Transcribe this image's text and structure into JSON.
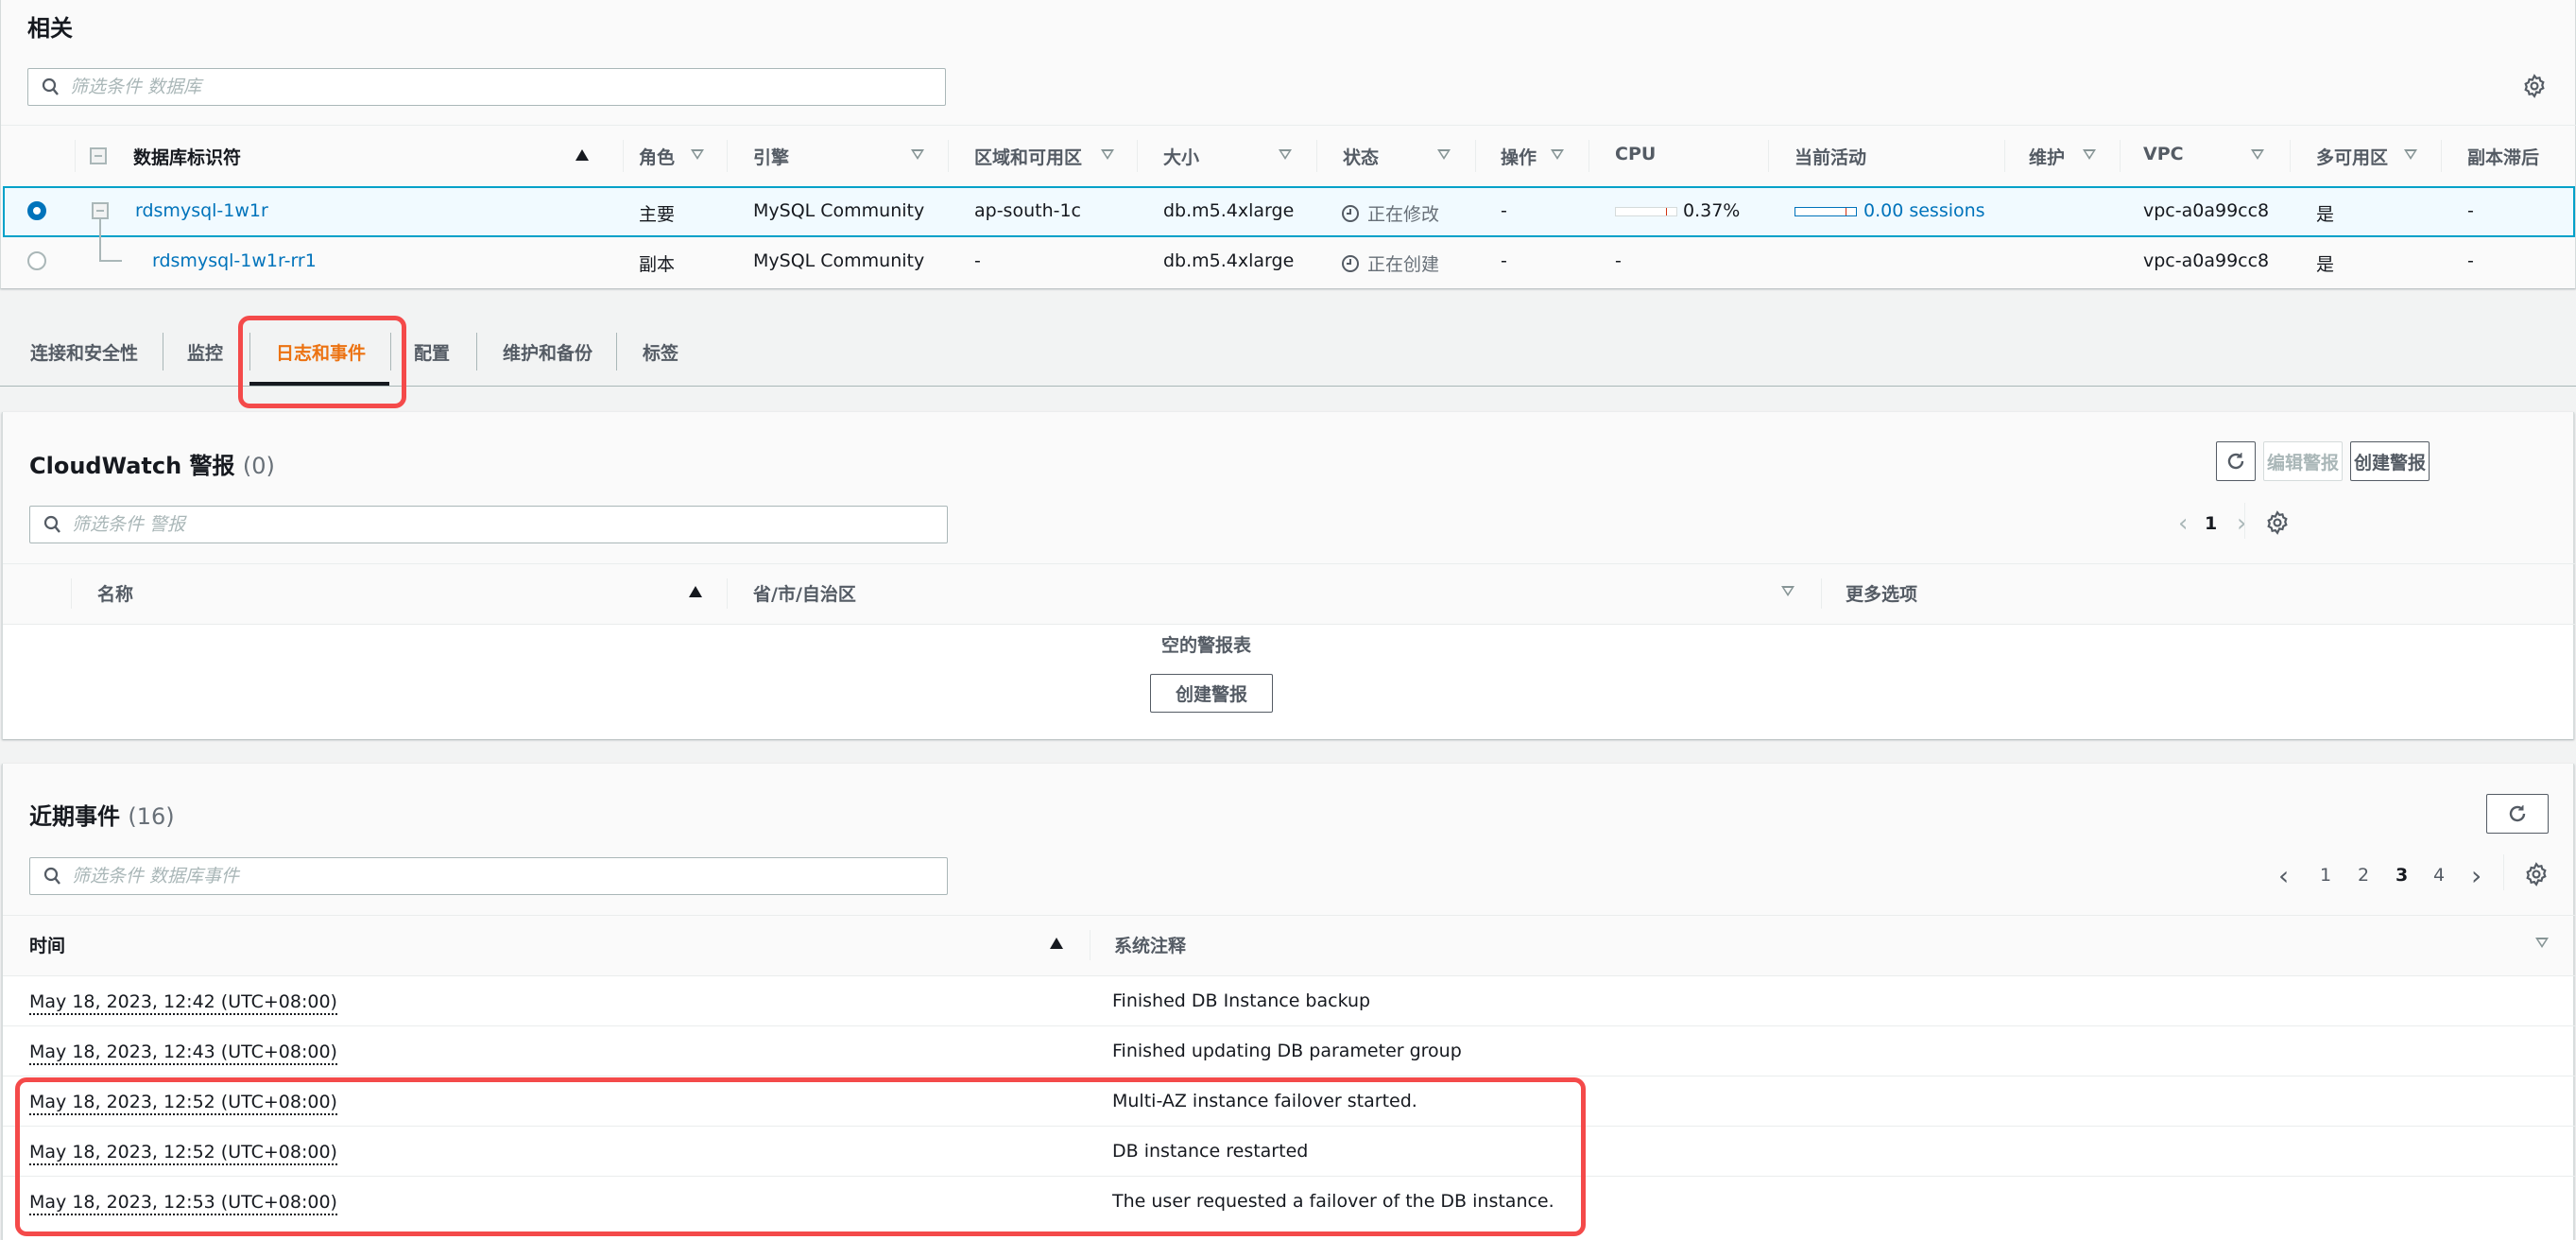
{
  "related": {
    "title": "相关",
    "search_placeholder": "筛选条件 数据库",
    "columns": [
      {
        "label": "数据库标识符",
        "sort": "asc"
      },
      {
        "label": "角色",
        "sort": "none"
      },
      {
        "label": "引擎",
        "sort": "none"
      },
      {
        "label": "区域和可用区",
        "sort": "none"
      },
      {
        "label": "大小",
        "sort": "none"
      },
      {
        "label": "状态",
        "sort": "none"
      },
      {
        "label": "操作",
        "sort": "none"
      },
      {
        "label": "CPU"
      },
      {
        "label": "当前活动"
      },
      {
        "label": "维护",
        "sort": "none"
      },
      {
        "label": "VPC",
        "sort": "none"
      },
      {
        "label": "多可用区",
        "sort": "none"
      },
      {
        "label": "副本滞后"
      }
    ],
    "rows": [
      {
        "selected": true,
        "identifier": "rdsmysql-1w1r",
        "role": "主要",
        "engine": "MySQL Community",
        "zone": "ap-south-1c",
        "size": "db.m5.4xlarge",
        "status": "正在修改",
        "actions": "-",
        "cpu": "0.37%",
        "cpu_fraction": 0.0037,
        "activity": "0.00 sessions",
        "maintenance": "",
        "vpc": "vpc-a0a99cc8",
        "multi_az": "是",
        "replica_lag": "-"
      },
      {
        "selected": false,
        "identifier": "rdsmysql-1w1r-rr1",
        "role": "副本",
        "engine": "MySQL Community",
        "zone": "-",
        "size": "db.m5.4xlarge",
        "status": "正在创建",
        "actions": "-",
        "cpu": "-",
        "activity": "",
        "maintenance": "",
        "vpc": "vpc-a0a99cc8",
        "multi_az": "是",
        "replica_lag": "-"
      }
    ]
  },
  "tabs": [
    {
      "label": "连接和安全性",
      "active": false
    },
    {
      "label": "监控",
      "active": false
    },
    {
      "label": "日志和事件",
      "active": true
    },
    {
      "label": "配置",
      "active": false
    },
    {
      "label": "维护和备份",
      "active": false
    },
    {
      "label": "标签",
      "active": false
    }
  ],
  "cloudwatch": {
    "title": "CloudWatch 警报",
    "count": "(0)",
    "edit_label": "编辑警报",
    "create_label": "创建警报",
    "search_placeholder": "筛选条件 警报",
    "page": "1",
    "columns": [
      "名称",
      "省/市/自治区",
      "更多选项"
    ],
    "empty_text": "空的警报表",
    "empty_create_label": "创建警报"
  },
  "events": {
    "title": "近期事件",
    "count": "(16)",
    "search_placeholder": "筛选条件 数据库事件",
    "pages": [
      "1",
      "2",
      "3",
      "4"
    ],
    "current_page": "3",
    "columns": [
      "时间",
      "系统注释"
    ],
    "rows": [
      {
        "time": "May 18, 2023, 12:42 (UTC+08:00)",
        "message": "Finished DB Instance backup"
      },
      {
        "time": "May 18, 2023, 12:43 (UTC+08:00)",
        "message": "Finished updating DB parameter group"
      },
      {
        "time": "May 18, 2023, 12:52 (UTC+08:00)",
        "message": "Multi-AZ instance failover started."
      },
      {
        "time": "May 18, 2023, 12:52 (UTC+08:00)",
        "message": "DB instance restarted"
      },
      {
        "time": "May 18, 2023, 12:53 (UTC+08:00)",
        "message": "The user requested a failover of the DB instance."
      }
    ]
  },
  "colors": {
    "accent": "#ec7211",
    "link": "#0073bb",
    "selected_border": "#00a1c9",
    "highlight": "#f44a4a"
  }
}
